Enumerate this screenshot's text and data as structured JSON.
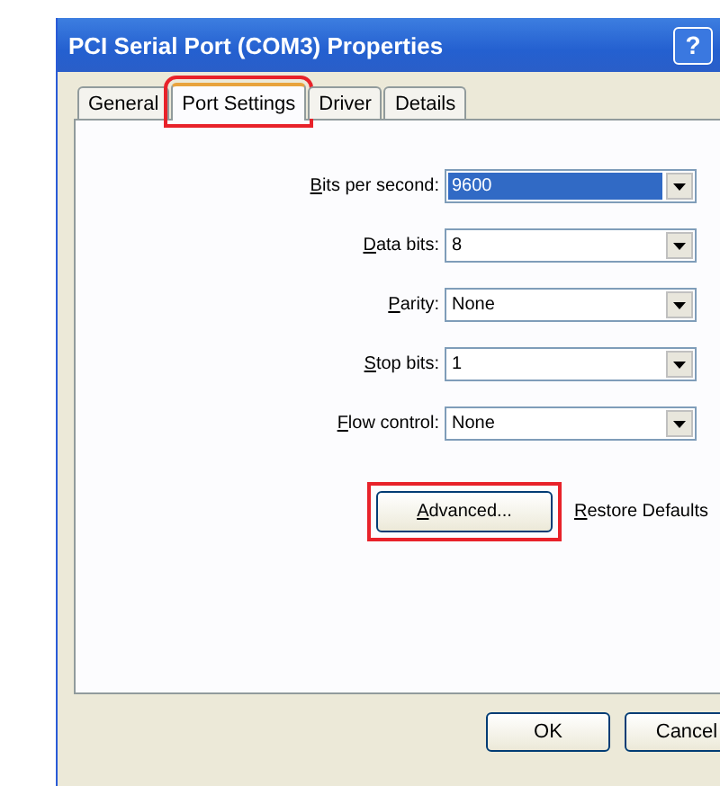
{
  "window": {
    "title": "PCI Serial Port (COM3) Properties",
    "help_button": "?"
  },
  "tabs": [
    {
      "label": "General",
      "selected": false,
      "highlighted": false
    },
    {
      "label": "Port Settings",
      "selected": true,
      "highlighted": true
    },
    {
      "label": "Driver",
      "selected": false,
      "highlighted": false
    },
    {
      "label": "Details",
      "selected": false,
      "highlighted": false
    }
  ],
  "settings": [
    {
      "label_key": "B",
      "label_rest": "its per second:",
      "value": "9600",
      "focused": true
    },
    {
      "label_key": "D",
      "label_rest": "ata bits:",
      "value": "8",
      "focused": false
    },
    {
      "label_key": "P",
      "label_rest": "arity:",
      "value": "None",
      "focused": false
    },
    {
      "label_key": "S",
      "label_rest": "top bits:",
      "value": "1",
      "focused": false
    },
    {
      "label_key": "F",
      "label_rest": "low control:",
      "value": "None",
      "focused": false
    }
  ],
  "panel_buttons": [
    {
      "label_key": "A",
      "label_rest": "dvanced...",
      "highlighted": true
    },
    {
      "label_key": "R",
      "label_rest": "estore Defaults",
      "highlighted": false
    }
  ],
  "dialog_buttons": [
    {
      "label": "OK"
    },
    {
      "label": "Cancel"
    }
  ]
}
